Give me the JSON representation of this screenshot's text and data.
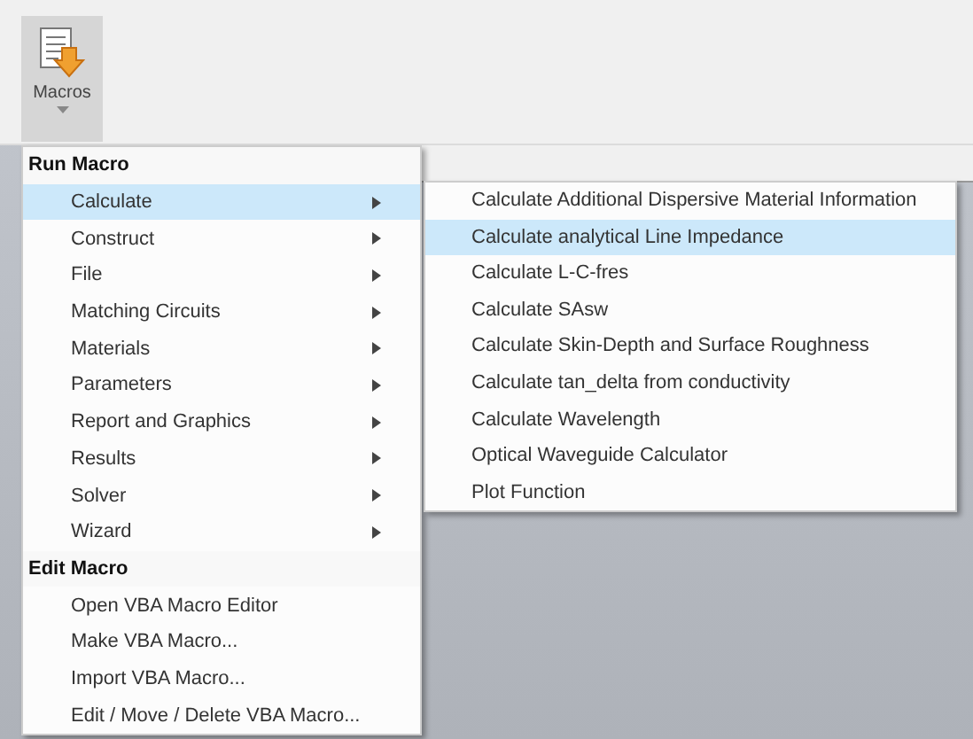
{
  "ribbon": {
    "button": {
      "label": "Macros",
      "selected": true
    }
  },
  "menu": {
    "sections": [
      {
        "header": "Run Macro",
        "items": [
          {
            "label": "Calculate",
            "submenu": true,
            "selected": true
          },
          {
            "label": "Construct",
            "submenu": true,
            "selected": false
          },
          {
            "label": "File",
            "submenu": true,
            "selected": false
          },
          {
            "label": "Matching Circuits",
            "submenu": true,
            "selected": false
          },
          {
            "label": "Materials",
            "submenu": true,
            "selected": false
          },
          {
            "label": "Parameters",
            "submenu": true,
            "selected": false
          },
          {
            "label": "Report and Graphics",
            "submenu": true,
            "selected": false
          },
          {
            "label": "Results",
            "submenu": true,
            "selected": false
          },
          {
            "label": "Solver",
            "submenu": true,
            "selected": false
          },
          {
            "label": "Wizard",
            "submenu": true,
            "selected": false
          }
        ]
      },
      {
        "header": "Edit Macro",
        "items": [
          {
            "label": "Open VBA Macro Editor",
            "submenu": false,
            "selected": false
          },
          {
            "label": "Make VBA Macro...",
            "submenu": false,
            "selected": false
          },
          {
            "label": "Import VBA Macro...",
            "submenu": false,
            "selected": false
          },
          {
            "label": "Edit / Move / Delete VBA Macro...",
            "submenu": false,
            "selected": false
          }
        ]
      }
    ]
  },
  "submenu": {
    "items": [
      {
        "label": "Calculate Additional Dispersive Material Information",
        "selected": false
      },
      {
        "label": "Calculate analytical Line Impedance",
        "selected": true
      },
      {
        "label": "Calculate L-C-fres",
        "selected": false
      },
      {
        "label": "Calculate SAsw",
        "selected": false
      },
      {
        "label": "Calculate Skin-Depth and Surface Roughness",
        "selected": false
      },
      {
        "label": "Calculate tan_delta from conductivity",
        "selected": false
      },
      {
        "label": "Calculate Wavelength",
        "selected": false
      },
      {
        "label": "Optical Waveguide Calculator",
        "selected": false
      },
      {
        "label": "Plot Function",
        "selected": false
      }
    ]
  }
}
